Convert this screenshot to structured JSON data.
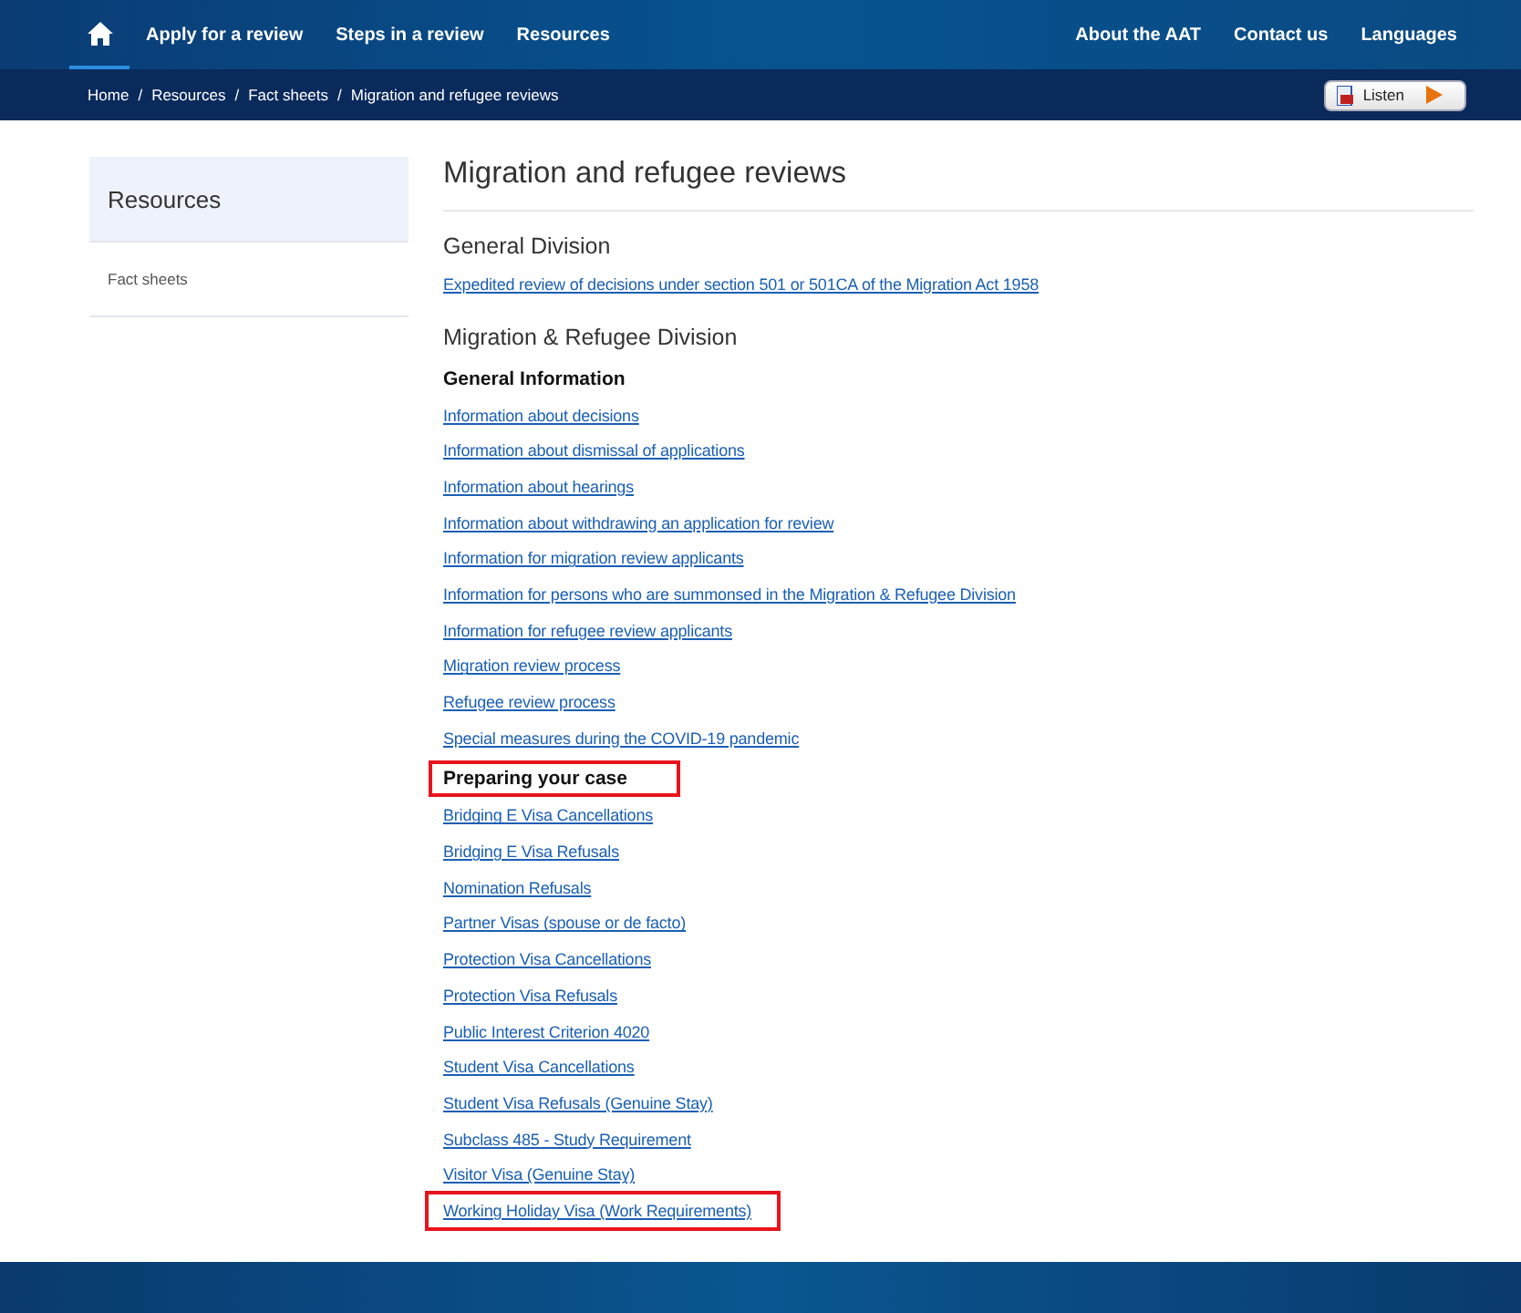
{
  "nav": {
    "home_selected": true,
    "left": [
      {
        "label": "Apply for a review"
      },
      {
        "label": "Steps in a review"
      },
      {
        "label": "Resources"
      }
    ],
    "right": [
      {
        "label": "About the AAT"
      },
      {
        "label": "Contact us"
      },
      {
        "label": "Languages"
      }
    ]
  },
  "breadcrumb": [
    {
      "text": "Home"
    },
    {
      "separator_before": "/",
      "text": "Resources"
    },
    {
      "separator_before": "/",
      "text": "Fact sheets"
    },
    {
      "separator_before": "/",
      "text": "Migration and refugee reviews"
    }
  ],
  "listen": {
    "label": "Listen"
  },
  "sidebar": {
    "title": "Resources",
    "items": [
      "Fact sheets"
    ]
  },
  "page_title": "Migration and refugee reviews",
  "content": [
    {
      "kind": "division",
      "text": "General Division"
    },
    {
      "kind": "link",
      "text": "Expedited review of decisions under section 501 or 501CA of the Migration Act 1958",
      "highlighted": false
    },
    {
      "kind": "division",
      "text": "Migration & Refugee Division"
    },
    {
      "kind": "subheading",
      "text": "General Information",
      "highlighted": false
    },
    {
      "kind": "link",
      "text": "Information about decisions",
      "highlighted": false
    },
    {
      "kind": "link",
      "text": "Information about dismissal of applications",
      "highlighted": false
    },
    {
      "kind": "link",
      "text": "Information about hearings",
      "highlighted": false
    },
    {
      "kind": "link",
      "text": "Information about withdrawing an application for review",
      "highlighted": false
    },
    {
      "kind": "link",
      "text": "Information for migration review applicants",
      "highlighted": false
    },
    {
      "kind": "link",
      "text": "Information for persons who are summonsed in the Migration & Refugee Division",
      "highlighted": false
    },
    {
      "kind": "link",
      "text": "Information for refugee review applicants",
      "highlighted": false
    },
    {
      "kind": "link",
      "text": "Migration review process",
      "highlighted": false
    },
    {
      "kind": "link",
      "text": "Refugee review process",
      "highlighted": false
    },
    {
      "kind": "link",
      "text": "Special measures during the COVID-19 pandemic",
      "highlighted": false
    },
    {
      "kind": "subheading",
      "text": "Preparing your case",
      "highlighted": true
    },
    {
      "kind": "link",
      "text": "Bridging E Visa Cancellations",
      "highlighted": false
    },
    {
      "kind": "link",
      "text": "Bridging E Visa Refusals",
      "highlighted": false
    },
    {
      "kind": "link",
      "text": "Nomination Refusals",
      "highlighted": false
    },
    {
      "kind": "link",
      "text": "Partner Visas (spouse or de facto)",
      "highlighted": false
    },
    {
      "kind": "link",
      "text": "Protection Visa Cancellations",
      "highlighted": false
    },
    {
      "kind": "link",
      "text": "Protection Visa Refusals",
      "highlighted": false
    },
    {
      "kind": "link",
      "text": "Public Interest Criterion 4020",
      "highlighted": false
    },
    {
      "kind": "link",
      "text": "Student Visa Cancellations",
      "highlighted": false
    },
    {
      "kind": "link",
      "text": "Student Visa Refusals (Genuine Stay)",
      "highlighted": false
    },
    {
      "kind": "link",
      "text": "Subclass 485 - Study Requirement",
      "highlighted": false
    },
    {
      "kind": "link",
      "text": "Visitor Visa (Genuine Stay)",
      "highlighted": false
    },
    {
      "kind": "link",
      "text": "Working Holiday Visa (Work Requirements)",
      "highlighted": true
    }
  ]
}
